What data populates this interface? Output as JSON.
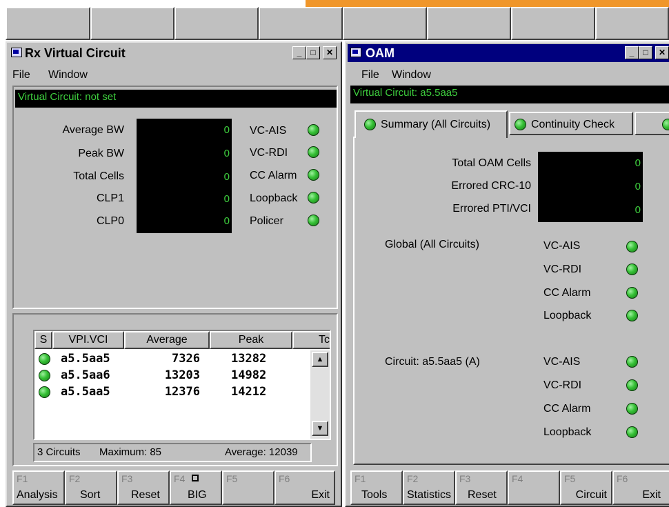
{
  "top_buttons": [
    "",
    "",
    "",
    "",
    "",
    "",
    "",
    ""
  ],
  "accent_color": "#f0962a",
  "rx": {
    "title": "Rx Virtual Circuit",
    "menu": [
      "File",
      "Window"
    ],
    "status": "Virtual Circuit: not set",
    "metrics": [
      {
        "label": "Average BW",
        "value": "0"
      },
      {
        "label": "Peak BW",
        "value": "0"
      },
      {
        "label": "Total Cells",
        "value": "0"
      },
      {
        "label": "CLP1",
        "value": "0"
      },
      {
        "label": "CLP0",
        "value": "0"
      }
    ],
    "indicators": [
      "VC-AIS",
      "VC-RDI",
      "CC Alarm",
      "Loopback",
      "Policer"
    ],
    "table": {
      "columns": [
        "S",
        "VPI.VCI",
        "Average",
        "Peak",
        "Tc"
      ],
      "rows": [
        {
          "vpivci": "a5.5aa5",
          "average": "7326",
          "peak": "13282"
        },
        {
          "vpivci": "a5.5aa6",
          "average": "13203",
          "peak": "14982"
        },
        {
          "vpivci": "a5.5aa5",
          "average": "12376",
          "peak": "14212"
        }
      ],
      "footer": {
        "circuits": "3 Circuits",
        "maximum": "Maximum: 85",
        "average": "Average: 12039"
      }
    },
    "fkeys": [
      {
        "num": "F1",
        "label": "Analysis"
      },
      {
        "num": "F2",
        "label": "Sort"
      },
      {
        "num": "F3",
        "label": "Reset"
      },
      {
        "num": "F4",
        "label": "BIG"
      },
      {
        "num": "F5",
        "label": ""
      },
      {
        "num": "F6",
        "label": "Exit"
      }
    ]
  },
  "oam": {
    "title": "OAM",
    "menu": [
      "File",
      "Window"
    ],
    "status": "Virtual Circuit:  a5.5aa5",
    "tabs": [
      "Summary (All Circuits)",
      "Continuity Check"
    ],
    "metrics": [
      {
        "label": "Total OAM Cells",
        "value": "0"
      },
      {
        "label": "Errored CRC-10",
        "value": "0"
      },
      {
        "label": "Errored PTI/VCI",
        "value": "0"
      }
    ],
    "global_label": "Global (All Circuits)",
    "circuit_label": "Circuit: a5.5aa5 (A)",
    "indicators": [
      "VC-AIS",
      "VC-RDI",
      "CC Alarm",
      "Loopback"
    ],
    "fkeys": [
      {
        "num": "F1",
        "label": "Tools"
      },
      {
        "num": "F2",
        "label": "Statistics"
      },
      {
        "num": "F3",
        "label": "Reset"
      },
      {
        "num": "F4",
        "label": ""
      },
      {
        "num": "F5",
        "label": "Circuit"
      },
      {
        "num": "F6",
        "label": "Exit"
      }
    ]
  }
}
